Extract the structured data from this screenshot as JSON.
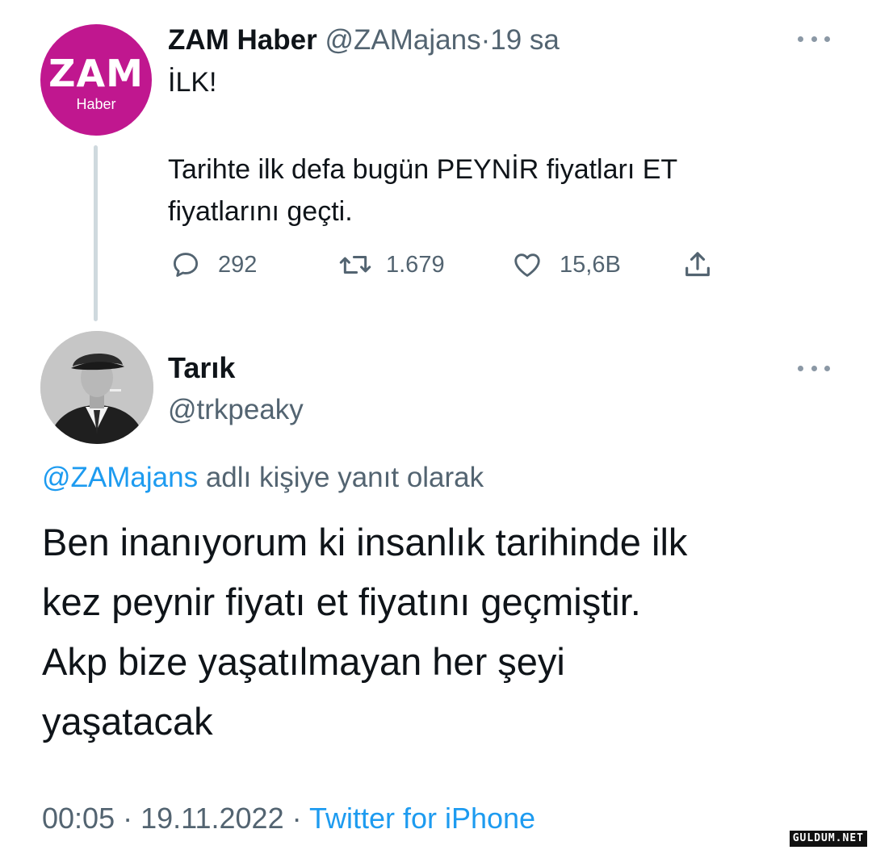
{
  "parent_tweet": {
    "avatar": {
      "logo_text": "ZAM",
      "logo_subtext": "Haber",
      "color": "#c0178f"
    },
    "display_name": "ZAM Haber",
    "handle": "@ZAMajans",
    "separator": "·",
    "time": "19 sa",
    "more_icon": "more-dots-icon",
    "text_lines": [
      "İLK!",
      "Tarihte ilk defa bugün PEYNİR fiyatları ET",
      "fiyatlarını geçti."
    ],
    "actions": {
      "reply": {
        "icon": "comment-icon",
        "count": "292"
      },
      "retweet": {
        "icon": "retweet-icon",
        "count": "1.679"
      },
      "like": {
        "icon": "heart-icon",
        "count": "15,6B"
      },
      "share": {
        "icon": "share-icon"
      }
    }
  },
  "reply_tweet": {
    "avatar": {
      "description": "profile photo"
    },
    "display_name": "Tarık",
    "handle": "@trkpeaky",
    "more_icon": "more-dots-icon",
    "reply_context": {
      "mention": "@ZAMajans",
      "suffix": " adlı kişiye yanıt olarak"
    },
    "text_lines": [
      "Ben inanıyorum ki insanlık tarihinde ilk",
      "kez peynir fiyatı et fiyatını geçmiştir.",
      "Akp bize yaşatılmayan her şeyi",
      "yaşatacak"
    ],
    "footer": {
      "time": "00:05",
      "separator": " · ",
      "date": "19.11.2022",
      "separator2": " · ",
      "source": "Twitter for iPhone"
    }
  },
  "watermark": "GULDUM.NET",
  "colors": {
    "link": "#1d9bf0",
    "secondary_text": "#536471",
    "primary_text": "#0f1419",
    "thread_line": "#cfd9de"
  }
}
